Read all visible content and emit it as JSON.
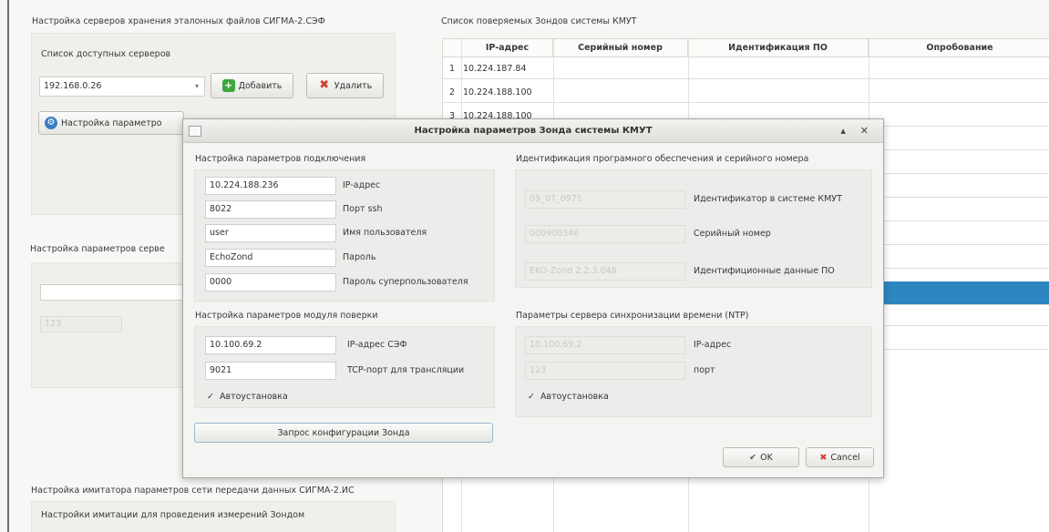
{
  "left": {
    "storage_title": "Настройка серверов хранения эталонных файлов СИГМА-2.СЭФ",
    "server_list_label": "Список доступных серверов",
    "server_selected": "192.168.0.26",
    "add_label": "Добавить",
    "delete_label": "Удалить",
    "settings_label": "Настройка параметро",
    "server_params_title": "Настройка параметров серве",
    "field_value": "123",
    "imitator_title": "Настройка имитатора параметров сети передачи данных СИГМА-2.ИС",
    "imitator_sub": "Настройки имитации для проведения измерений Зондом"
  },
  "table": {
    "title": "Список поверяемых Зондов системы КМУТ",
    "headers": [
      "IP-адрес",
      "Серийный номер",
      "Идентификация ПО",
      "Опробование"
    ],
    "rows": [
      {
        "num": "1",
        "ip": "10.224.187.84"
      },
      {
        "num": "2",
        "ip": "10.224.188.100"
      },
      {
        "num": "3",
        "ip": "10.224.188.100"
      }
    ]
  },
  "dialog": {
    "title": "Настройка параметров Зонда системы КМУТ",
    "controls": "▴ ✕",
    "connection": {
      "title": "Настройка параметров подключения",
      "fields": [
        {
          "value": "10.224.188.236",
          "label": "IP-адрес"
        },
        {
          "value": "8022",
          "label": "Порт ssh"
        },
        {
          "value": "user",
          "label": "Имя пользователя"
        },
        {
          "value": "EchoZond",
          "label": "Пароль"
        },
        {
          "value": "0000",
          "label": "Пароль суперпользователя"
        }
      ]
    },
    "verify": {
      "title": "Настройка параметров модуля поверки",
      "fields": [
        {
          "value": "10.100.69.2",
          "label": "IP-адрес СЭФ"
        },
        {
          "value": "9021",
          "label": "TCP-порт для трансляции"
        }
      ],
      "auto_label": "Автоустановка",
      "request_label": "Запрос конфигурации Зонда"
    },
    "ident": {
      "title": "Идентификация програмного обеспечения и серийного номера",
      "fields": [
        {
          "value": "09_07_0971",
          "label": "Идентификатор в системе КМУТ"
        },
        {
          "value": "000900346",
          "label": "Серийный номер"
        },
        {
          "value": "EKO-Zond 2.2.3.048",
          "label": "Идентифиционные данные ПО"
        }
      ]
    },
    "ntp": {
      "title": "Параметры сервера синхронизации времени (NTP)",
      "fields": [
        {
          "value": "10.100.69.2",
          "label": "IP-адрес"
        },
        {
          "value": "123",
          "label": "порт"
        }
      ],
      "auto_label": "Автоустановка"
    },
    "ok_label": "OK",
    "cancel_label": "Cancel"
  },
  "colors": {
    "selection": "#2e86c1",
    "add_icon": "#3da83d",
    "delete_icon": "#d23b2b"
  }
}
